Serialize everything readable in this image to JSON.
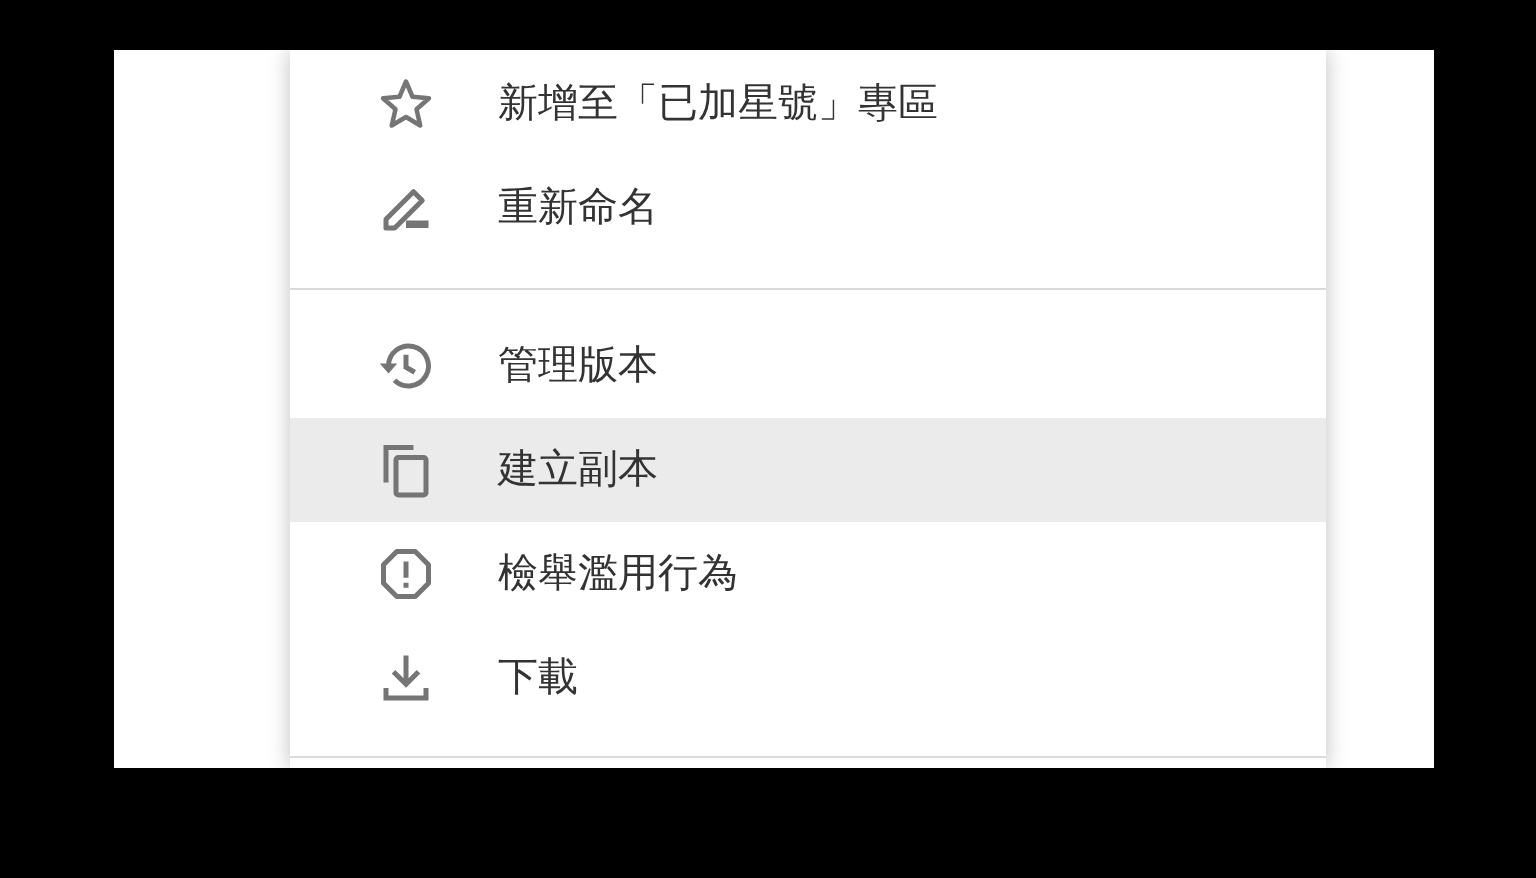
{
  "menu": {
    "groups": [
      {
        "items": [
          {
            "kind": "star",
            "label": "新增至「已加星號」專區",
            "selected": false
          },
          {
            "kind": "rename",
            "label": "重新命名",
            "selected": false
          }
        ]
      },
      {
        "items": [
          {
            "kind": "history",
            "label": "管理版本",
            "selected": false
          },
          {
            "kind": "copy",
            "label": "建立副本",
            "selected": true
          },
          {
            "kind": "report",
            "label": "檢舉濫用行為",
            "selected": false
          },
          {
            "kind": "download",
            "label": "下載",
            "selected": false
          }
        ]
      }
    ]
  }
}
